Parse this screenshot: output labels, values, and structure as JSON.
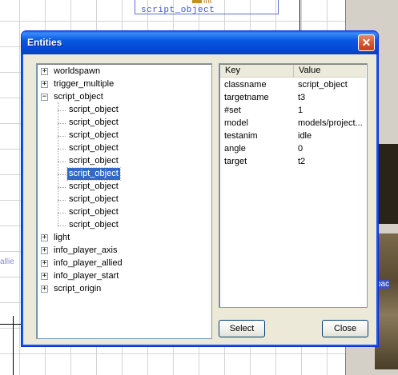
{
  "background": {
    "entity_label": "script_object",
    "origin_label": "int",
    "left_label": "allie",
    "right_texture_label": "oac"
  },
  "dialog": {
    "title": "Entities",
    "close_glyph": "✕"
  },
  "tree": {
    "nodes": [
      {
        "label": "worldspawn",
        "expander": "+"
      },
      {
        "label": "trigger_multiple",
        "expander": "+"
      },
      {
        "label": "script_object",
        "expander": "−"
      },
      {
        "label": "script_object"
      },
      {
        "label": "script_object"
      },
      {
        "label": "script_object"
      },
      {
        "label": "script_object"
      },
      {
        "label": "script_object"
      },
      {
        "label": "script_object",
        "selected": true
      },
      {
        "label": "script_object"
      },
      {
        "label": "script_object"
      },
      {
        "label": "script_object"
      },
      {
        "label": "script_object"
      },
      {
        "label": "light",
        "expander": "+"
      },
      {
        "label": "info_player_axis",
        "expander": "+"
      },
      {
        "label": "info_player_allied",
        "expander": "+"
      },
      {
        "label": "info_player_start",
        "expander": "+"
      },
      {
        "label": "script_origin",
        "expander": "+"
      }
    ]
  },
  "props": {
    "columns": {
      "key": "Key",
      "value": "Value"
    },
    "rows": [
      {
        "key": "classname",
        "value": "script_object"
      },
      {
        "key": "targetname",
        "value": "t3"
      },
      {
        "key": "#set",
        "value": "1"
      },
      {
        "key": "model",
        "value": "models/project..."
      },
      {
        "key": "testanim",
        "value": "idle"
      },
      {
        "key": "angle",
        "value": "0"
      },
      {
        "key": "target",
        "value": "t2"
      }
    ]
  },
  "buttons": {
    "select": "Select",
    "close": "Close"
  },
  "colors": {
    "titlebar": "#0858e0",
    "selection": "#316ac5",
    "dialog_bg": "#ece9d8"
  }
}
